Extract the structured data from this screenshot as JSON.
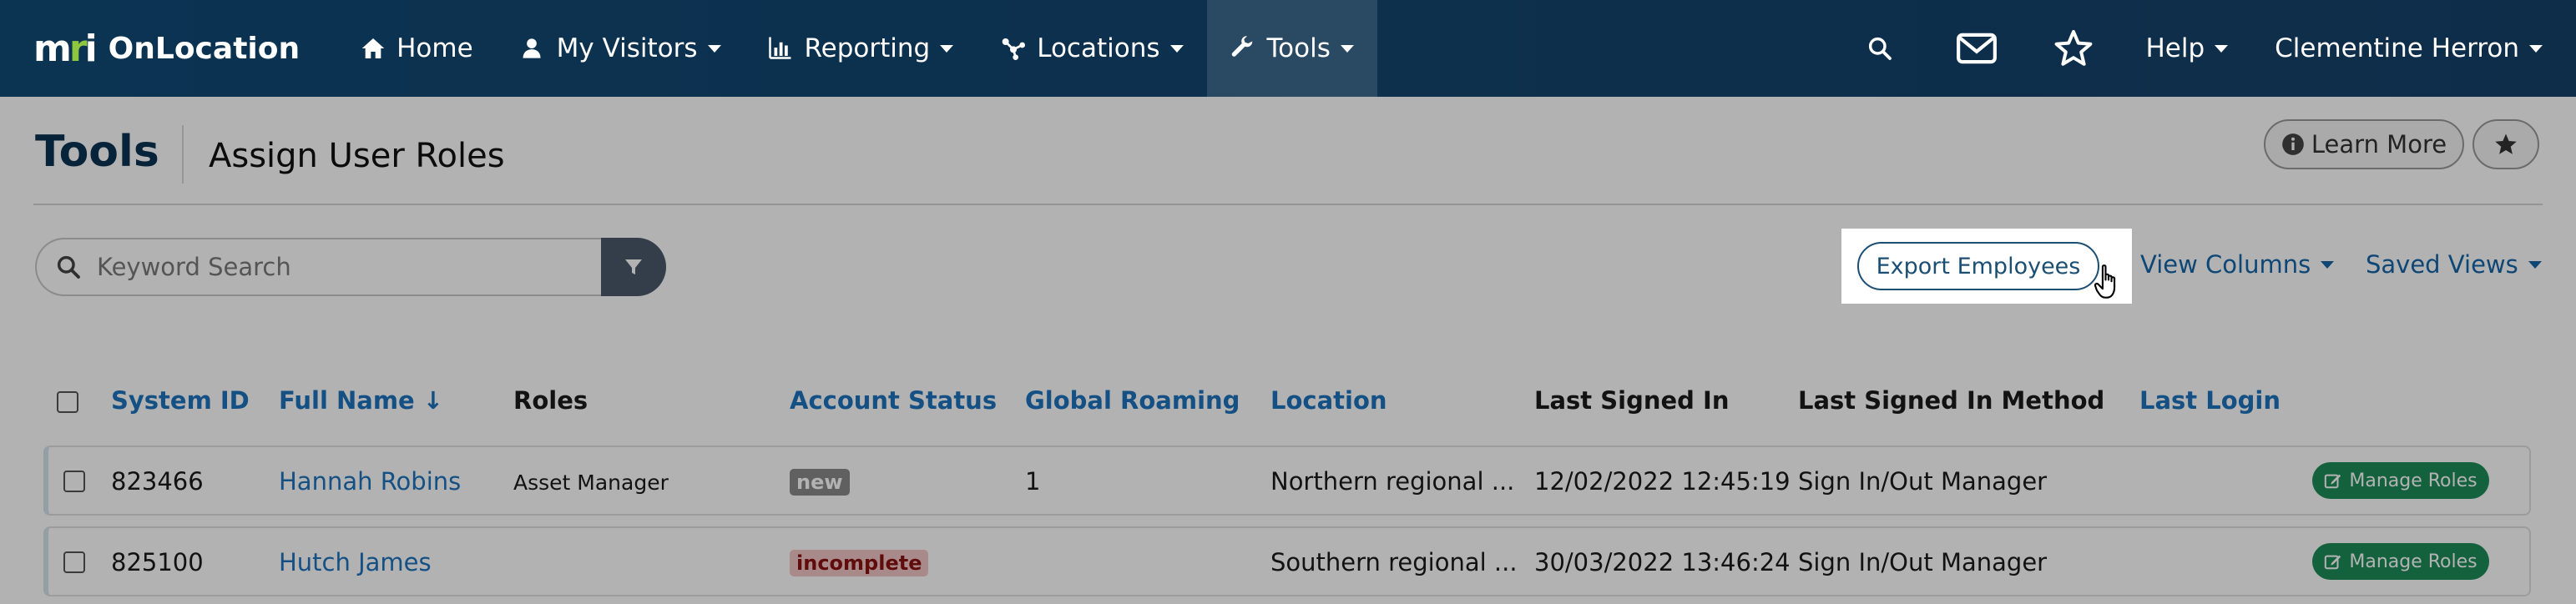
{
  "brand": {
    "mark": "mri",
    "name": "OnLocation"
  },
  "nav": {
    "items": [
      {
        "label": "Home",
        "icon": "home-icon",
        "dropdown": false
      },
      {
        "label": "My Visitors",
        "icon": "user-icon",
        "dropdown": true
      },
      {
        "label": "Reporting",
        "icon": "bar-chart-icon",
        "dropdown": true
      },
      {
        "label": "Locations",
        "icon": "network-icon",
        "dropdown": true
      },
      {
        "label": "Tools",
        "icon": "wrench-icon",
        "dropdown": true,
        "active": true
      }
    ],
    "help_label": "Help",
    "user_name": "Clementine Herron"
  },
  "page": {
    "title": "Tools",
    "subtitle": "Assign User Roles",
    "learn_more_label": "Learn More"
  },
  "search": {
    "placeholder": "Keyword Search"
  },
  "toolbar": {
    "export_label": "Export Employees",
    "view_columns_label": "View Columns",
    "saved_views_label": "Saved Views"
  },
  "table": {
    "columns": [
      {
        "label": "System ID",
        "link": true
      },
      {
        "label": "Full Name ↓",
        "link": true
      },
      {
        "label": "Roles",
        "link": false
      },
      {
        "label": "Account Status",
        "link": true
      },
      {
        "label": "Global Roaming",
        "link": true
      },
      {
        "label": "Location",
        "link": true
      },
      {
        "label": "Last Signed In",
        "link": false
      },
      {
        "label": "Last Signed In Method",
        "link": false
      },
      {
        "label": "Last Login",
        "link": true
      }
    ],
    "rows": [
      {
        "system_id": "823466",
        "full_name": "Hannah Robins",
        "roles": "Asset Manager",
        "account_status": "new",
        "global_roaming": "1",
        "location": "Northern regional ...",
        "last_signed_in": "12/02/2022 12:45:19",
        "last_signed_in_method": "Sign In/Out Manager",
        "last_login": "",
        "action_label": "Manage Roles"
      },
      {
        "system_id": "825100",
        "full_name": "Hutch James",
        "roles": "",
        "account_status": "incomplete",
        "global_roaming": "",
        "location": "Southern regional ...",
        "last_signed_in": "30/03/2022 13:46:24",
        "last_signed_in_method": "Sign In/Out Manager",
        "last_login": "",
        "action_label": "Manage Roles"
      }
    ]
  },
  "colors": {
    "navbar": "#0b3352",
    "brand_accent": "#8dc63f",
    "link": "#1e73be",
    "action_green": "#1e8c5a",
    "badge_incomplete_bg": "#f2c6c6"
  }
}
